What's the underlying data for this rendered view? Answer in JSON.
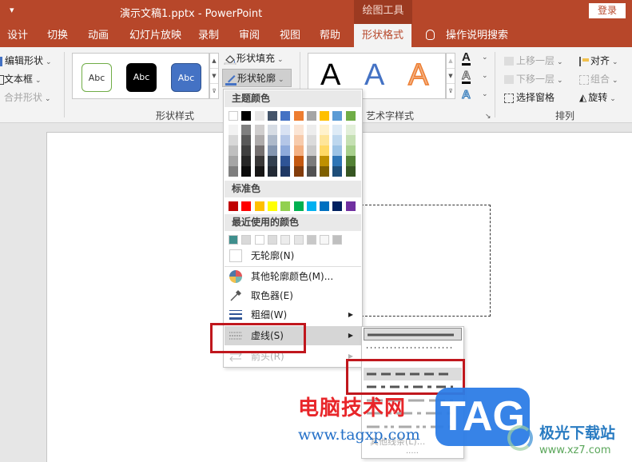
{
  "titlebar": {
    "quick_access": "▾",
    "title": "演示文稿1.pptx  -  PowerPoint",
    "context_group": "绘图工具",
    "login": "登录"
  },
  "tabs": [
    {
      "label": "设计"
    },
    {
      "label": "切换"
    },
    {
      "label": "动画"
    },
    {
      "label": "幻灯片放映"
    },
    {
      "label": "录制"
    },
    {
      "label": "审阅"
    },
    {
      "label": "视图"
    },
    {
      "label": "帮助"
    },
    {
      "label": "形状格式",
      "active": true
    },
    {
      "label": "操作说明搜索"
    }
  ],
  "ribbon": {
    "insert_shapes": {
      "edit_shape": "编辑形状",
      "text_box": "文本框",
      "merge_shapes": "合并形状"
    },
    "shape_styles": {
      "label": "形状样式",
      "presets": [
        {
          "text": "Abc",
          "fill": "#ffffff",
          "border": "#70ad47",
          "color": "#333333"
        },
        {
          "text": "Abc",
          "fill": "#000000",
          "border": "#000000",
          "color": "#ffffff"
        },
        {
          "text": "Abc",
          "fill": "#4472c4",
          "border": "#2f528f",
          "color": "#ffffff"
        }
      ],
      "shape_fill": "形状填充",
      "shape_outline": "形状轮廓"
    },
    "wordart_styles": {
      "label": "艺术字样式",
      "letters": [
        "A",
        "A",
        "A"
      ]
    },
    "arrange": {
      "label": "排列",
      "bring_forward": "上移一层",
      "send_backward": "下移一层",
      "selection_pane": "选择窗格",
      "align": "对齐",
      "group": "组合",
      "rotate": "旋转"
    }
  },
  "outline_menu": {
    "theme_colors_header": "主题颜色",
    "theme_colors": [
      "#ffffff",
      "#000000",
      "#e7e6e6",
      "#44546a",
      "#4472c4",
      "#ed7d31",
      "#a5a5a5",
      "#ffc000",
      "#5b9bd5",
      "#70ad47"
    ],
    "theme_shades": [
      [
        "#f2f2f2",
        "#7f7f7f",
        "#d0cece",
        "#d6dce4",
        "#d9e2f3",
        "#fbe5d5",
        "#ededed",
        "#fff2cc",
        "#deebf6",
        "#e2efd9"
      ],
      [
        "#d8d8d8",
        "#595959",
        "#aeabab",
        "#adb9ca",
        "#b4c6e7",
        "#f7cbac",
        "#dbdbdb",
        "#fee599",
        "#bdd7ee",
        "#c5e0b3"
      ],
      [
        "#bfbfbf",
        "#3f3f3f",
        "#757070",
        "#8496b0",
        "#8eaadb",
        "#f4b183",
        "#c9c9c9",
        "#ffd965",
        "#9cc3e5",
        "#a8d08d"
      ],
      [
        "#a5a5a5",
        "#262626",
        "#3a3838",
        "#323f4f",
        "#2f5496",
        "#c45911",
        "#7b7b7b",
        "#bf9000",
        "#2e75b5",
        "#538135"
      ],
      [
        "#7f7f7f",
        "#0c0c0c",
        "#171616",
        "#222a35",
        "#1f3864",
        "#833c0b",
        "#525252",
        "#7f6000",
        "#1e4e79",
        "#375623"
      ]
    ],
    "standard_colors_header": "标准色",
    "standard_colors": [
      "#c00000",
      "#ff0000",
      "#ffc000",
      "#ffff00",
      "#92d050",
      "#00b050",
      "#00b0f0",
      "#0070c0",
      "#002060",
      "#7030a0"
    ],
    "recent_colors_header": "最近使用的颜色",
    "recent_colors": [
      "#3f8f8d",
      "#d9d9d9",
      "#ffffff",
      "#dcdcdc",
      "#ececec",
      "#e5e5e5",
      "#c8c8c8",
      "#f7f7f7",
      "#bfbfbf"
    ],
    "items": [
      {
        "label": "无轮廓(N)",
        "icon": "no-outline-swatch"
      },
      {
        "label": "其他轮廓颜色(M)...",
        "icon": "color-wheel-icon"
      },
      {
        "label": "取色器(E)",
        "icon": "eyedropper-icon"
      },
      {
        "label": "粗细(W)",
        "icon": "line-weight-icon",
        "submenu": true
      },
      {
        "label": "虚线(S)",
        "icon": "dashes-icon",
        "submenu": true,
        "highlighted": true
      },
      {
        "label": "箭头(R)",
        "icon": "arrows-icon",
        "submenu": true,
        "disabled": true
      }
    ]
  },
  "dash_submenu": {
    "options": [
      "solid",
      "round-dot",
      "square-dot",
      "dash",
      "dash-dot",
      "long-dash",
      "long-dash-dot",
      "long-dash-dot-dot"
    ],
    "selected": "solid",
    "hovered": "dash",
    "more": "其他线条(L)...",
    "more_dots": "....."
  },
  "watermarks": {
    "site_cn": "电脑技术网",
    "site_url": "www.tagxp.com",
    "tag": "TAG",
    "xz_cn": "极光下载站",
    "xz_url": "www.xz7.com"
  }
}
